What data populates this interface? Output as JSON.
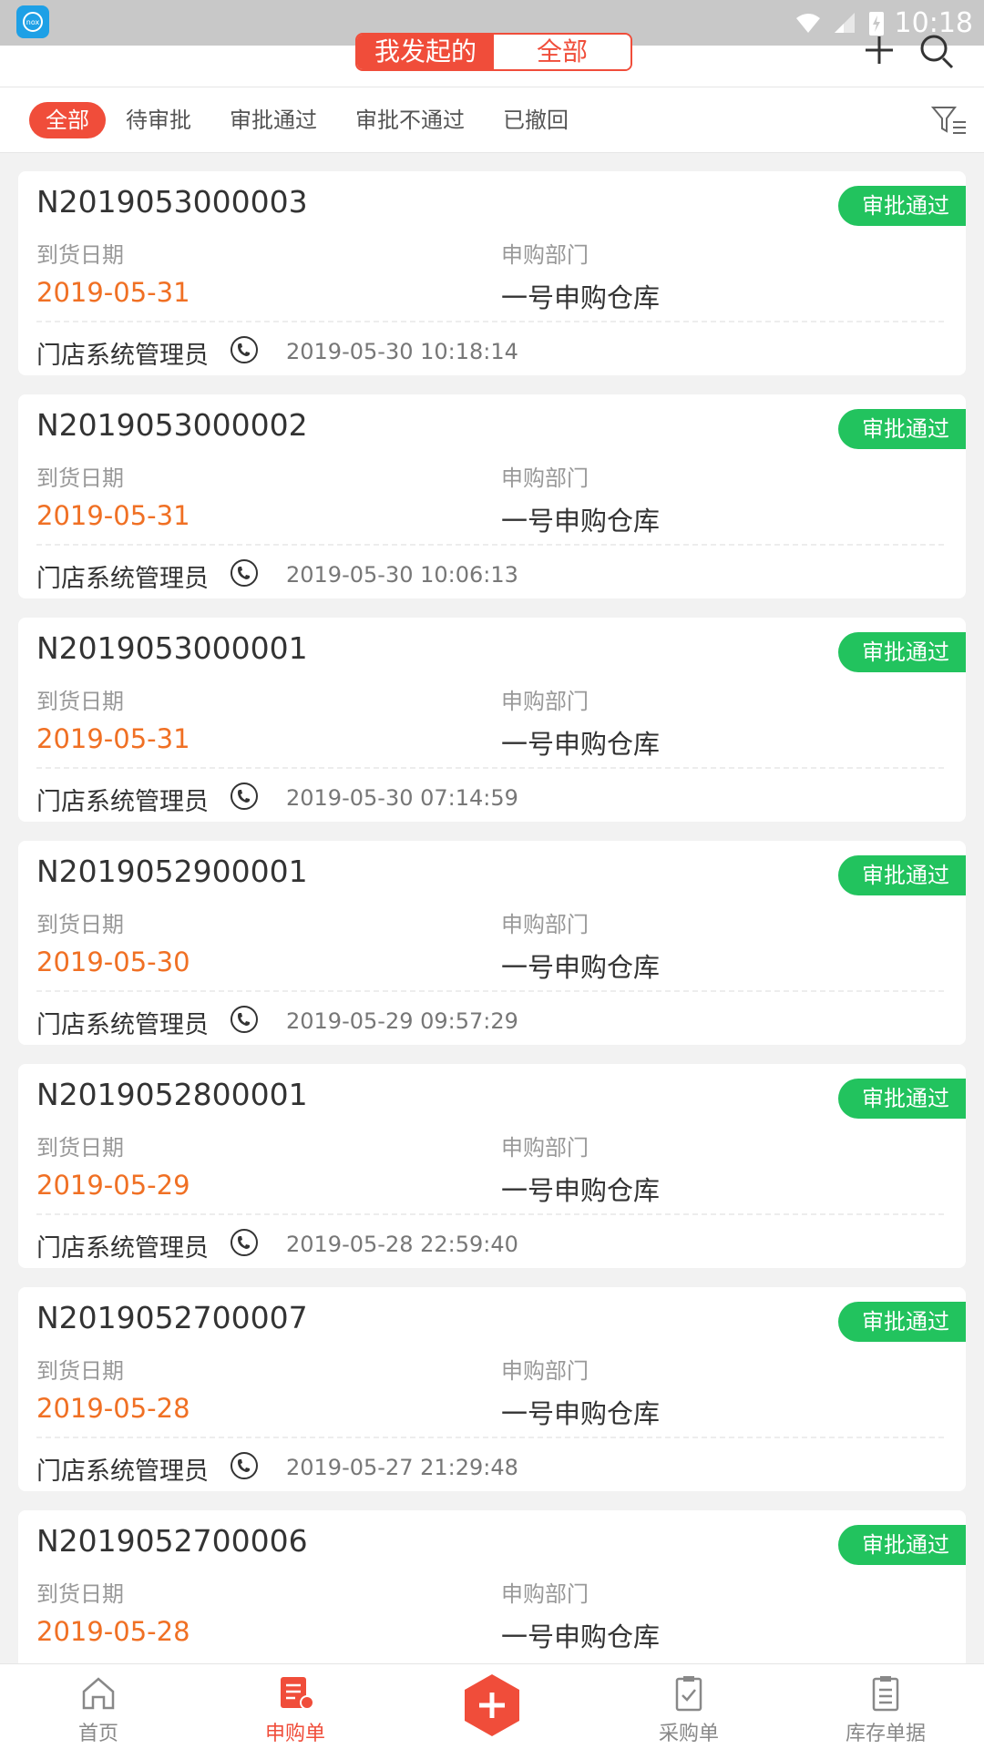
{
  "statusbar": {
    "time": "10:18",
    "app_icon_text": "nox"
  },
  "header": {
    "segments": [
      "我发起的",
      "全部"
    ],
    "plus_icon": "plus-icon",
    "search_icon": "search-icon"
  },
  "tabs": [
    "全部",
    "待审批",
    "审批通过",
    "审批不通过",
    "已撤回"
  ],
  "list": {
    "date_label": "到货日期",
    "dept_label": "申购部门",
    "items": [
      {
        "code": "N2019053000003",
        "status": "审批通过",
        "date": "2019-05-31",
        "dept": "一号申购仓库",
        "creator": "门店系统管理员",
        "time": "2019-05-30 10:18:14"
      },
      {
        "code": "N2019053000002",
        "status": "审批通过",
        "date": "2019-05-31",
        "dept": "一号申购仓库",
        "creator": "门店系统管理员",
        "time": "2019-05-30 10:06:13"
      },
      {
        "code": "N2019053000001",
        "status": "审批通过",
        "date": "2019-05-31",
        "dept": "一号申购仓库",
        "creator": "门店系统管理员",
        "time": "2019-05-30 07:14:59"
      },
      {
        "code": "N2019052900001",
        "status": "审批通过",
        "date": "2019-05-30",
        "dept": "一号申购仓库",
        "creator": "门店系统管理员",
        "time": "2019-05-29 09:57:29"
      },
      {
        "code": "N2019052800001",
        "status": "审批通过",
        "date": "2019-05-29",
        "dept": "一号申购仓库",
        "creator": "门店系统管理员",
        "time": "2019-05-28 22:59:40"
      },
      {
        "code": "N2019052700007",
        "status": "审批通过",
        "date": "2019-05-28",
        "dept": "一号申购仓库",
        "creator": "门店系统管理员",
        "time": "2019-05-27 21:29:48"
      },
      {
        "code": "N2019052700006",
        "status": "审批通过",
        "date": "2019-05-28",
        "dept": "一号申购仓库",
        "creator": "",
        "time": ""
      }
    ]
  },
  "bottomnav": {
    "items": [
      {
        "label": "首页",
        "icon": "home-icon"
      },
      {
        "label": "申购单",
        "icon": "requisition-icon"
      },
      {
        "label": "采购单",
        "icon": "purchase-order-icon"
      },
      {
        "label": "库存单据",
        "icon": "inventory-doc-icon"
      }
    ],
    "fab_icon": "add-icon"
  },
  "colors": {
    "accent": "#f04d3a",
    "approved": "#22c35e",
    "date": "#f07024"
  }
}
